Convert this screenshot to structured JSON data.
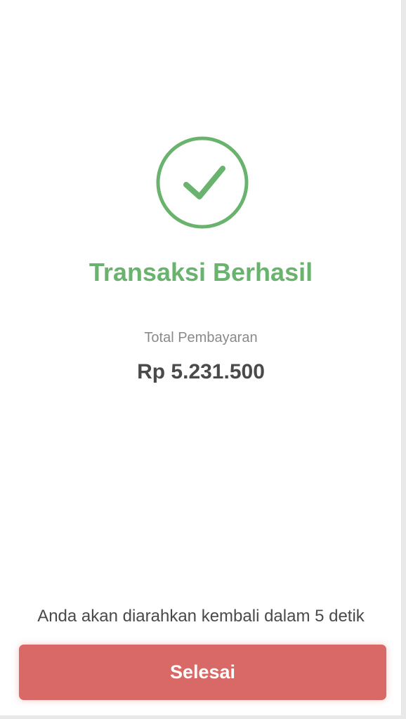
{
  "colors": {
    "success_green": "#6ab36e",
    "button_red": "#d96966",
    "text_dark": "#4a4a4a",
    "text_muted": "#8a8a8a"
  },
  "status": {
    "icon": "check-circle-icon",
    "title": "Transaksi Berhasil"
  },
  "payment": {
    "label": "Total Pembayaran",
    "amount": "Rp 5.231.500"
  },
  "redirect": {
    "message": "Anda akan diarahkan kembali dalam 5 detik"
  },
  "actions": {
    "done_label": "Selesai"
  }
}
